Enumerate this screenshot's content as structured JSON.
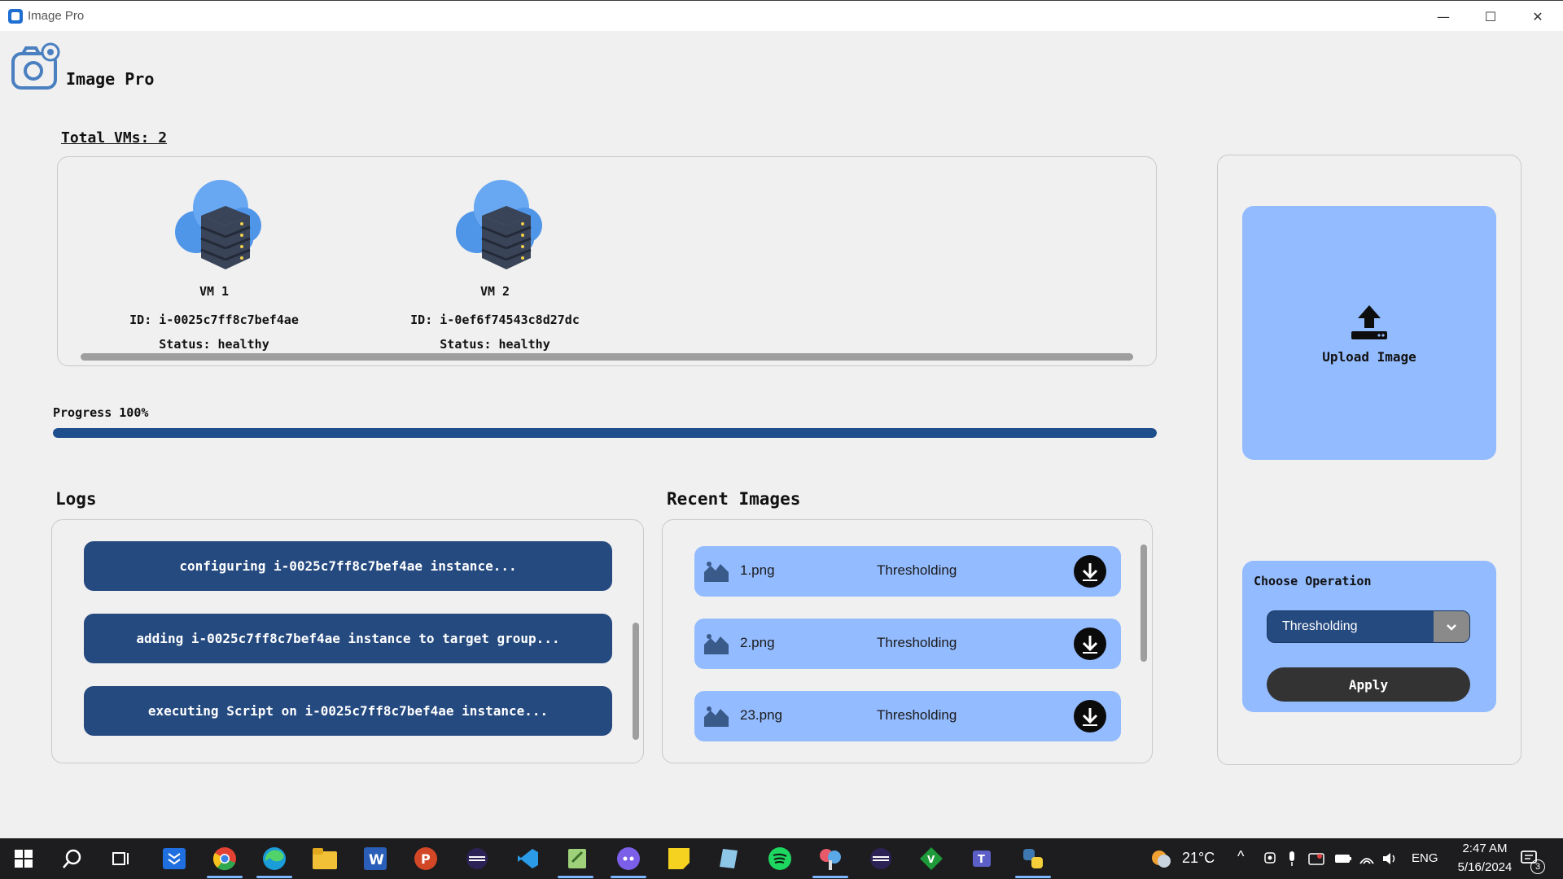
{
  "window": {
    "title": "Image Pro",
    "minimize_glyph": "—",
    "maximize_glyph": "☐",
    "close_glyph": "✕"
  },
  "header": {
    "app_name": "Image Pro",
    "logo_icon": "camera-gear-icon"
  },
  "vms": {
    "total_label": "Total VMs: 2",
    "items": [
      {
        "name": "VM 1",
        "id": "ID: i-0025c7ff8c7bef4ae",
        "status": "Status: healthy",
        "icon": "cloud-server-icon"
      },
      {
        "name": "VM 2",
        "id": "ID: i-0ef6f74543c8d27dc",
        "status": "Status: healthy",
        "icon": "cloud-server-icon"
      }
    ]
  },
  "progress": {
    "label": "Progress 100%",
    "value": 1.0
  },
  "logs": {
    "title": "Logs",
    "items": [
      "configuring i-0025c7ff8c7bef4ae instance...",
      "adding i-0025c7ff8c7bef4ae instance to target group...",
      "executing Script on i-0025c7ff8c7bef4ae instance..."
    ]
  },
  "recent_images": {
    "title": "Recent Images",
    "items": [
      {
        "file": "1.png",
        "operation": "Thresholding"
      },
      {
        "file": "2.png",
        "operation": "Thresholding"
      },
      {
        "file": "23.png",
        "operation": "Thresholding"
      }
    ]
  },
  "upload": {
    "label": "Upload Image",
    "icon": "upload-icon"
  },
  "operation": {
    "title": "Choose Operation",
    "selected": "Thresholding",
    "apply_label": "Apply"
  },
  "taskbar": {
    "weather": "21°C",
    "language": "ENG",
    "time": "2:47 AM",
    "date": "5/16/2024",
    "notification_count": "3",
    "apps": [
      "start-icon",
      "search-icon",
      "task-view-icon",
      "dropbox-icon",
      "chrome-icon",
      "edge-icon",
      "file-explorer-icon",
      "word-icon",
      "powerpoint-icon",
      "eclipse-icon",
      "vscode-icon",
      "notepadpp-icon",
      "discord-icon",
      "sticky-notes-icon",
      "app-icon",
      "spotify-icon",
      "snipping-tool-icon",
      "eclipse-icon",
      "vim-icon",
      "teams-icon",
      "python-icon"
    ]
  },
  "colors": {
    "accent_dark": "#254a80",
    "accent_light": "#93bbff",
    "progress": "#1f4e8c",
    "button_dark": "#333333"
  }
}
